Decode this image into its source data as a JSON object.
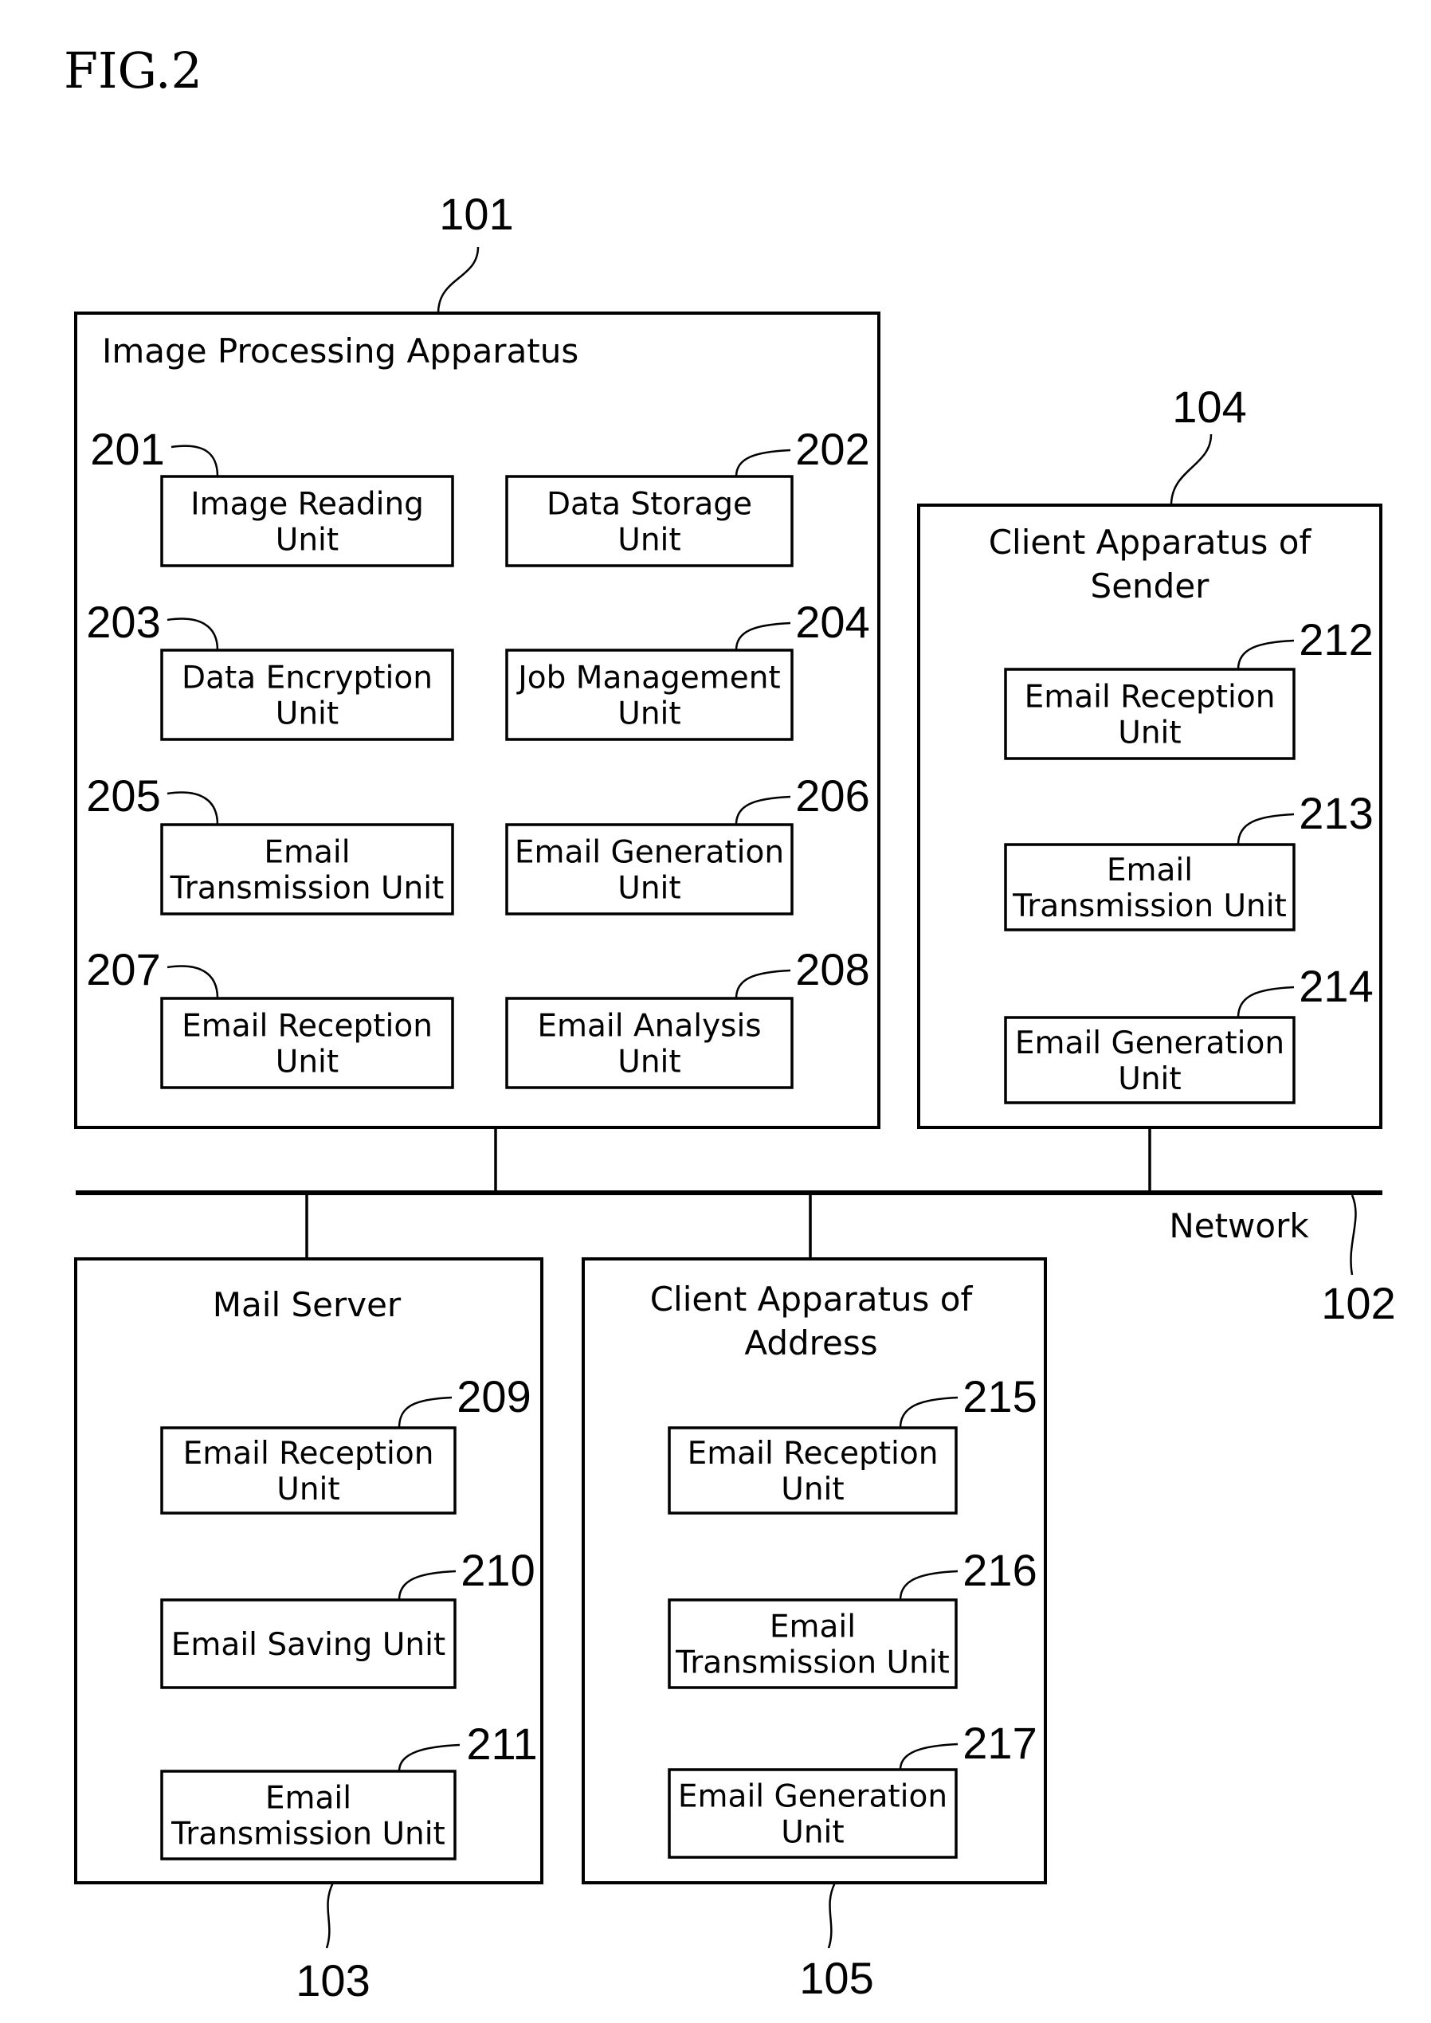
{
  "figure_label": "FIG.2",
  "network": {
    "label": "Network",
    "ref": "102"
  },
  "blocks": [
    {
      "id": "image-processing-apparatus",
      "ref": "101",
      "title_lines": [
        "Image Processing Apparatus"
      ],
      "units": [
        {
          "ref": "201",
          "lines": [
            "Image Reading",
            "Unit"
          ]
        },
        {
          "ref": "202",
          "lines": [
            "Data Storage",
            "Unit"
          ]
        },
        {
          "ref": "203",
          "lines": [
            "Data Encryption",
            "Unit"
          ]
        },
        {
          "ref": "204",
          "lines": [
            "Job Management",
            "Unit"
          ]
        },
        {
          "ref": "205",
          "lines": [
            "Email",
            "Transmission Unit"
          ]
        },
        {
          "ref": "206",
          "lines": [
            "Email Generation",
            "Unit"
          ]
        },
        {
          "ref": "207",
          "lines": [
            "Email Reception",
            "Unit"
          ]
        },
        {
          "ref": "208",
          "lines": [
            "Email Analysis",
            "Unit"
          ]
        }
      ]
    },
    {
      "id": "client-apparatus-of-sender",
      "ref": "104",
      "title_lines": [
        "Client Apparatus of",
        "Sender"
      ],
      "units": [
        {
          "ref": "212",
          "lines": [
            "Email Reception",
            "Unit"
          ]
        },
        {
          "ref": "213",
          "lines": [
            "Email",
            "Transmission Unit"
          ]
        },
        {
          "ref": "214",
          "lines": [
            "Email Generation",
            "Unit"
          ]
        }
      ]
    },
    {
      "id": "mail-server",
      "ref": "103",
      "title_lines": [
        "Mail Server"
      ],
      "units": [
        {
          "ref": "209",
          "lines": [
            "Email Reception",
            "Unit"
          ]
        },
        {
          "ref": "210",
          "lines": [
            "Email Saving Unit"
          ]
        },
        {
          "ref": "211",
          "lines": [
            "Email",
            "Transmission Unit"
          ]
        }
      ]
    },
    {
      "id": "client-apparatus-of-address",
      "ref": "105",
      "title_lines": [
        "Client Apparatus of",
        "Address"
      ],
      "units": [
        {
          "ref": "215",
          "lines": [
            "Email Reception",
            "Unit"
          ]
        },
        {
          "ref": "216",
          "lines": [
            "Email",
            "Transmission Unit"
          ]
        },
        {
          "ref": "217",
          "lines": [
            "Email Generation",
            "Unit"
          ]
        }
      ]
    }
  ]
}
